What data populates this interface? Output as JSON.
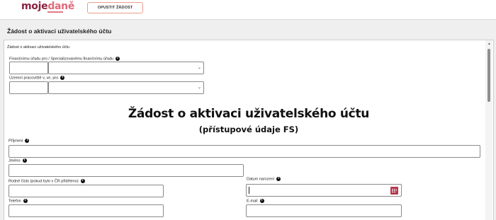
{
  "brand": {
    "logo_part1": "moje",
    "logo_part2": "daně"
  },
  "header": {
    "leave_button": "OPUSTIT ŽÁDOST",
    "title": "Žádost o aktivaci uživatelského účtu"
  },
  "form": {
    "breadcrumb": "Žádost o aktivaci uživatelského účtu",
    "office_label": "Finančnímu úřadu pro / Specializovanému finančnímu úřadu",
    "workplace_label": "Územní pracoviště v, ve, pro",
    "heading": "Žádost o aktivaci uživatelského účtu",
    "subheading": "(přístupové údaje FS)",
    "surname_label": "Příjmení",
    "name_label": "Jméno",
    "birth_number_label": "Rodné číslo (pokud bylo v ČR přiděleno)",
    "birth_date_label": "Datum narození",
    "phone_label": "Telefon",
    "email_label": "E-mail",
    "info_glyph": "i",
    "select_chevron": "⌄"
  },
  "colors": {
    "brand_dark": "#8a2340",
    "brand_light": "#e06a7a",
    "calendar": "#b5394e",
    "leave_border": "#e8a08a"
  },
  "icons": [
    "info-icon",
    "chevron-down-icon",
    "calendar-icon",
    "scroll-up-icon"
  ]
}
